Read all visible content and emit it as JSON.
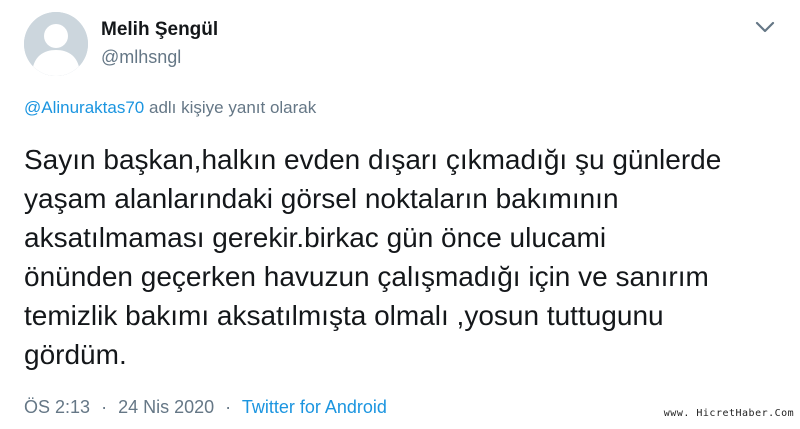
{
  "author": {
    "display_name": "Melih Şengül",
    "handle": "@mlhsngl",
    "avatar_icon": "default-avatar-icon"
  },
  "menu": {
    "icon": "chevron-down-icon"
  },
  "reply_context": {
    "mention": "@Alinuraktas70",
    "suffix": "adlı kişiye yanıt olarak"
  },
  "tweet": {
    "lines": [
      "Sayın başkan,halkın evden dışarı çıkmadığı şu günlerde",
      "yaşam alanlarındaki görsel noktaların bakımının",
      "aksatılmaması gerekir.birkac gün önce ulucami",
      "önünden geçerken havuzun çalışmadığı için ve sanırım",
      "temizlik bakımı aksatılmışta olmalı ,yosun tuttugunu",
      "gördüm."
    ]
  },
  "meta": {
    "time": "ÖS 2:13",
    "separator": "·",
    "date": "24 Nis 2020",
    "source": "Twitter for Android"
  },
  "watermark": {
    "text": "www. HicretHaber.Com"
  },
  "colors": {
    "text": "#14171a",
    "secondary": "#657786",
    "link": "#1b95e0",
    "avatar_bg": "#ccd6dd",
    "avatar_fg": "#ffffff"
  }
}
